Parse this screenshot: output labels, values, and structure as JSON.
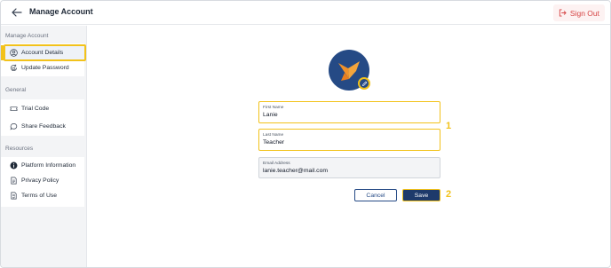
{
  "header": {
    "title": "Manage Account",
    "back_icon": "arrow-left-icon",
    "signout_label": "Sign Out",
    "signout_icon": "logout-icon",
    "signout_color": "#d64545"
  },
  "sidebar": {
    "sections": [
      {
        "label": "Manage Account",
        "items": [
          {
            "label": "Account Details",
            "icon": "user-circle-icon",
            "active": true
          },
          {
            "label": "Update Password",
            "icon": "lock-refresh-icon",
            "active": false
          }
        ]
      },
      {
        "label": "General",
        "items": [
          {
            "label": "Trial Code",
            "icon": "ticket-icon",
            "active": false
          },
          {
            "label": "Share Feedback",
            "icon": "chat-bubble-icon",
            "active": false
          }
        ]
      },
      {
        "label": "Resources",
        "items": [
          {
            "label": "Platform Information",
            "icon": "info-icon",
            "active": false
          },
          {
            "label": "Privacy Policy",
            "icon": "document-icon",
            "active": false
          },
          {
            "label": "Terms of Use",
            "icon": "document-check-icon",
            "active": false
          }
        ]
      }
    ]
  },
  "form": {
    "avatar_icon": "bird-logo-icon",
    "avatar_edit_icon": "pencil-icon",
    "first_name": {
      "label": "First Name",
      "value": "Lanie"
    },
    "last_name": {
      "label": "Last Name",
      "value": "Teacher"
    },
    "email": {
      "label": "Email Address",
      "value": "lanie.teacher@mail.com"
    },
    "cancel_label": "Cancel",
    "save_label": "Save"
  },
  "callouts": {
    "first": "1",
    "second": "2"
  },
  "colors": {
    "accent_highlight": "#f2c21b",
    "primary": "#1e3a6b",
    "avatar_bg": "#254a85"
  }
}
